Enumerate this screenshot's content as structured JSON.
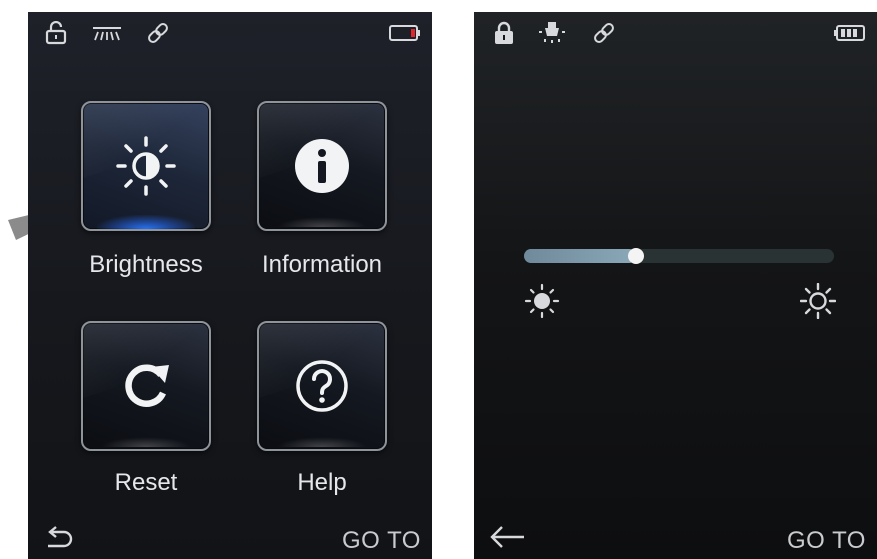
{
  "left_screen": {
    "status_icons": [
      "lock-open-icon",
      "light-beam-icon",
      "link-icon",
      "battery-low-icon"
    ],
    "tiles": [
      {
        "label": "Brightness",
        "icon": "brightness-icon",
        "selected": true
      },
      {
        "label": "Information",
        "icon": "info-icon",
        "selected": false
      },
      {
        "label": "Reset",
        "icon": "reset-icon",
        "selected": false
      },
      {
        "label": "Help",
        "icon": "help-icon",
        "selected": false
      }
    ],
    "back_icon": "back-icon",
    "goto_label": "GO TO"
  },
  "right_screen": {
    "status_icons": [
      "lock-closed-icon",
      "bulb-icon",
      "link-icon",
      "battery-full-icon"
    ],
    "brightness_slider": {
      "value": 0.36,
      "min_icon": "brightness-low-icon",
      "max_icon": "brightness-high-icon"
    },
    "back_icon": "arrow-left-icon",
    "goto_label": "GO TO"
  },
  "colors": {
    "accent_glow": "#2878ff",
    "battery_low": "#e0262b",
    "slider_fill": "#7f9cad"
  }
}
